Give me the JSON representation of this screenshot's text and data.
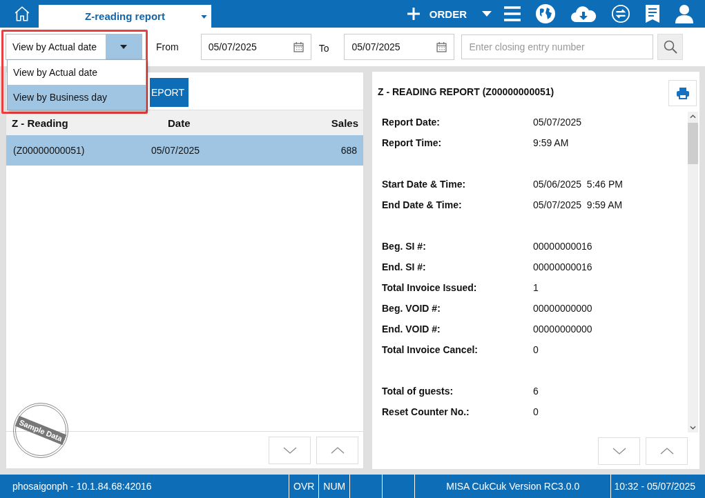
{
  "tab": {
    "title": "Z-reading report"
  },
  "toolbar": {
    "order_label": "ORDER"
  },
  "filter": {
    "view_mode": "View by Actual date",
    "from_label": "From",
    "from_date": "05/07/2025",
    "to_label": "To",
    "to_date": "05/07/2025",
    "search_placeholder": "Enter closing entry number",
    "dropdown": {
      "expanded": true,
      "options": [
        {
          "label": "View by Actual date",
          "selected": false
        },
        {
          "label": "View by Business day",
          "selected": true
        }
      ]
    }
  },
  "left_panel": {
    "report_button": "EPORT",
    "columns": [
      "Z - Reading",
      "Date",
      "Sales"
    ],
    "rows": [
      {
        "reading": "(Z00000000051)",
        "date": "05/07/2025",
        "sales": "688",
        "selected": true
      }
    ],
    "stamp": "Sample Data"
  },
  "report": {
    "title": "Z - READING REPORT (Z00000000051)",
    "sections": [
      [
        {
          "label": "Report Date:",
          "value": "05/07/2025"
        },
        {
          "label": "Report Time:",
          "value": "9:59 AM"
        }
      ],
      [
        {
          "label": "Start Date & Time:",
          "value": "05/06/2025  5:46 PM"
        },
        {
          "label": "End Date & Time:",
          "value": "05/07/2025  9:59 AM"
        }
      ],
      [
        {
          "label": "Beg. SI #:",
          "value": "00000000016"
        },
        {
          "label": "End. SI #:",
          "value": "00000000016"
        },
        {
          "label": "Total Invoice Issued:",
          "value": "1"
        },
        {
          "label": "Beg. VOID #:",
          "value": "00000000000"
        },
        {
          "label": "End. VOID #:",
          "value": "00000000000"
        },
        {
          "label": "Total Invoice Cancel:",
          "value": "0"
        }
      ],
      [
        {
          "label": "Total of guests:",
          "value": "6"
        },
        {
          "label": "Reset Counter No.:",
          "value": "0"
        }
      ]
    ]
  },
  "status_bar": {
    "connection": "phosaigonph - 10.1.84.68:42016",
    "ovr": "OVR",
    "num": "NUM",
    "version": "MISA CukCuk Version RC3.0.0",
    "datetime": "10:32 - 05/07/2025"
  }
}
